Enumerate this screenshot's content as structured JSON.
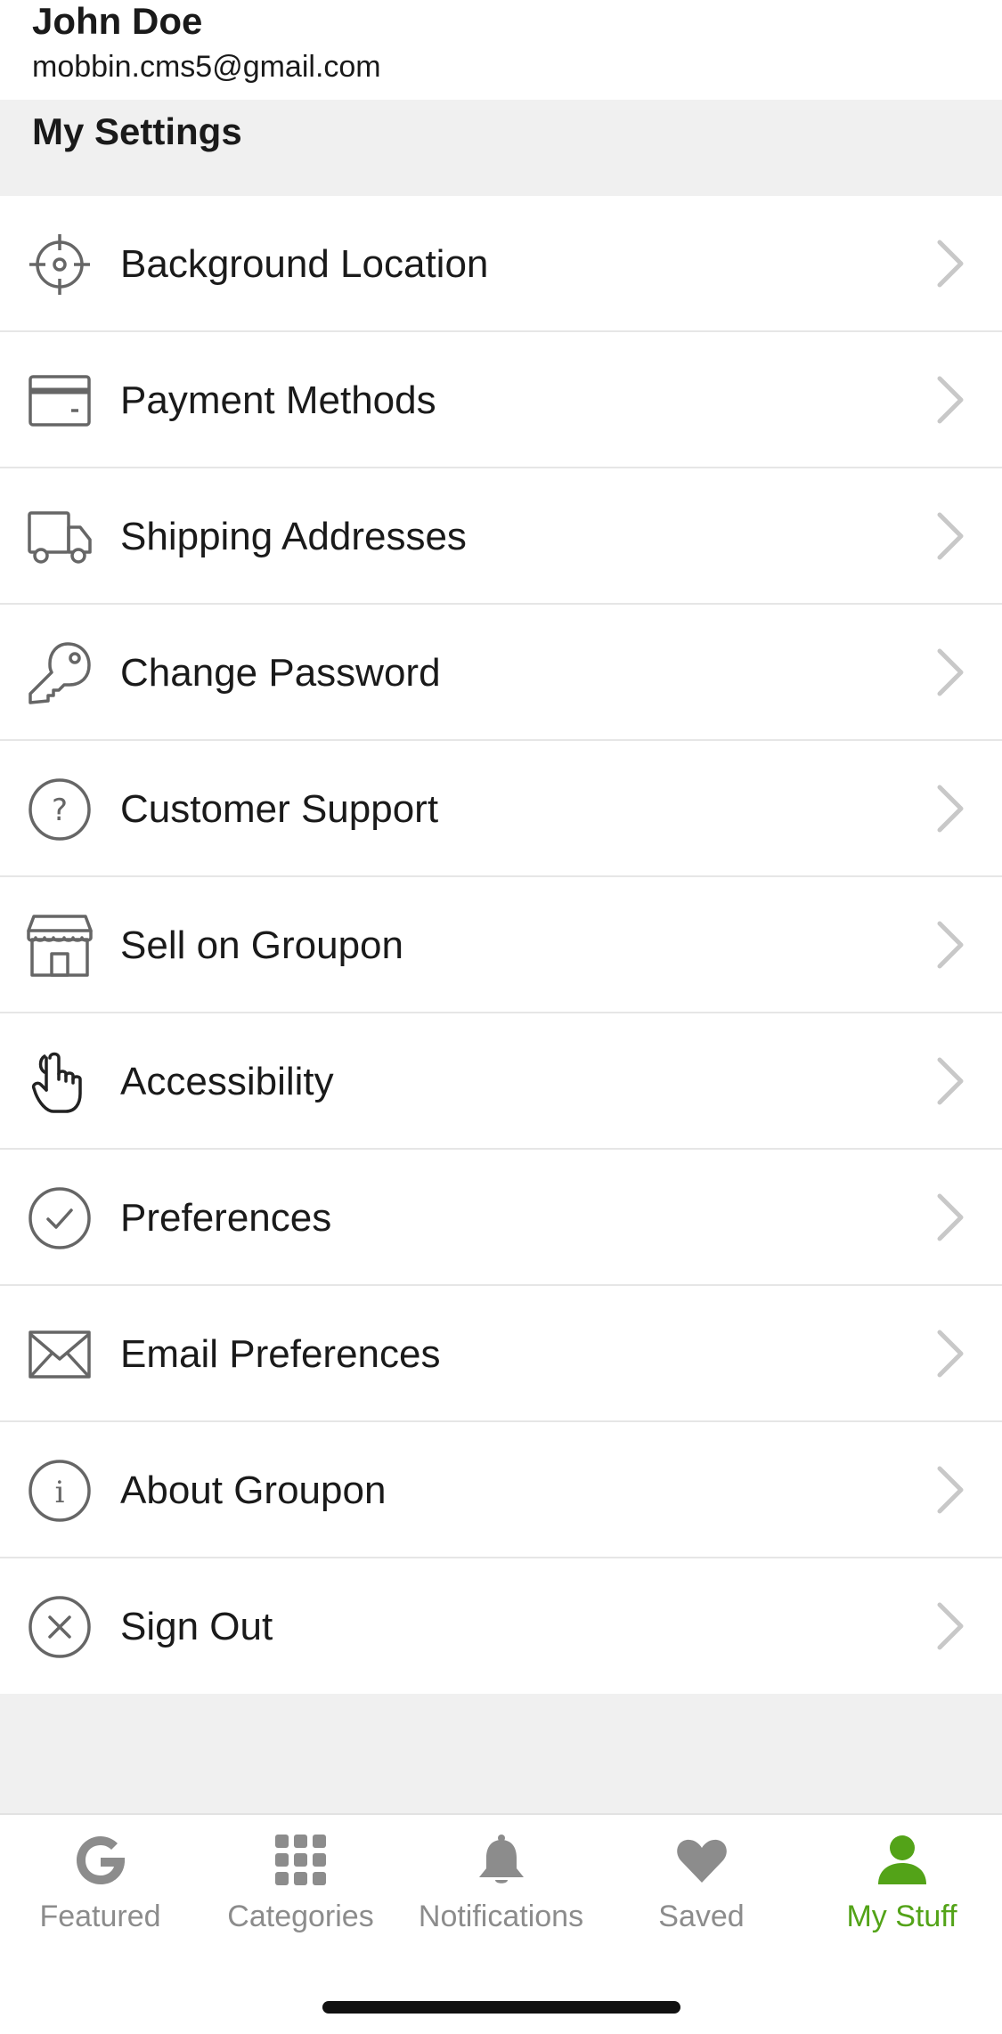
{
  "profile": {
    "name": "John Doe",
    "email": "mobbin.cms5@gmail.com"
  },
  "settings": {
    "title": "My Settings",
    "items": [
      {
        "label": "Background Location",
        "icon": "crosshair-icon"
      },
      {
        "label": "Payment Methods",
        "icon": "credit-card-icon"
      },
      {
        "label": "Shipping Addresses",
        "icon": "truck-icon"
      },
      {
        "label": "Change Password",
        "icon": "key-icon"
      },
      {
        "label": "Customer Support",
        "icon": "question-circle-icon"
      },
      {
        "label": "Sell on Groupon",
        "icon": "storefront-icon"
      },
      {
        "label": "Accessibility",
        "icon": "hand-pointer-icon"
      },
      {
        "label": "Preferences",
        "icon": "check-circle-icon"
      },
      {
        "label": "Email Preferences",
        "icon": "envelope-icon"
      },
      {
        "label": "About Groupon",
        "icon": "info-circle-icon"
      },
      {
        "label": "Sign Out",
        "icon": "x-circle-icon"
      }
    ]
  },
  "tabbar": {
    "tabs": [
      {
        "label": "Featured",
        "icon": "groupon-g-icon",
        "active": false
      },
      {
        "label": "Categories",
        "icon": "grid-icon",
        "active": false
      },
      {
        "label": "Notifications",
        "icon": "bell-icon",
        "active": false
      },
      {
        "label": "Saved",
        "icon": "heart-icon",
        "active": false
      },
      {
        "label": "My Stuff",
        "icon": "person-icon",
        "active": true
      }
    ]
  },
  "colors": {
    "accent": "#53a318",
    "inactive": "#8c8c8c",
    "icon": "#666666",
    "chevron": "#c8c8c8",
    "section_bg": "#f0f0f0"
  }
}
